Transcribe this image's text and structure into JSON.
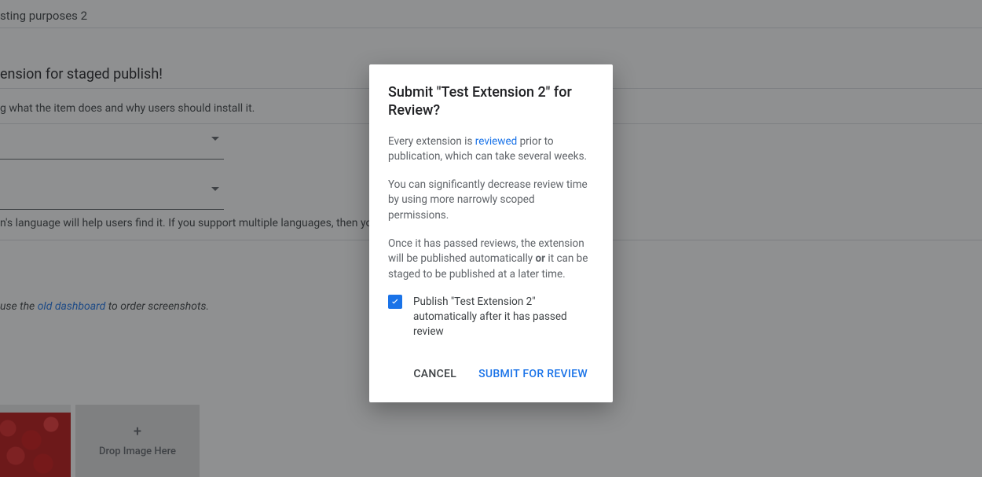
{
  "background": {
    "title_fragment": "sting purposes 2",
    "subtitle_fragment": "ension for staged publish!",
    "description_hint_fragment": "g what the item does and why users should install it.",
    "language_hint_fragment": "n's language will help users find it. If you support multiple languages, then you sh",
    "screenshots_hint_prefix": "use the ",
    "screenshots_link": "old dashboard",
    "screenshots_hint_suffix": " to order screenshots.",
    "drop_label": "Drop Image Here"
  },
  "dialog": {
    "title": "Submit \"Test Extension 2\" for Review?",
    "p1_a": "Every extension is ",
    "p1_link": "reviewed",
    "p1_b": " prior to publication, which can take several weeks.",
    "p2": "You can significantly decrease review time by using more narrowly scoped permissions.",
    "p3_a": "Once it has passed reviews, the extension will be published automatically ",
    "p3_bold": "or",
    "p3_b": " it can be staged to be published at a later time.",
    "checkbox_label": "Publish \"Test Extension 2\" automatically after it has passed review",
    "checkbox_checked": true,
    "cancel": "CANCEL",
    "submit": "SUBMIT FOR REVIEW"
  }
}
